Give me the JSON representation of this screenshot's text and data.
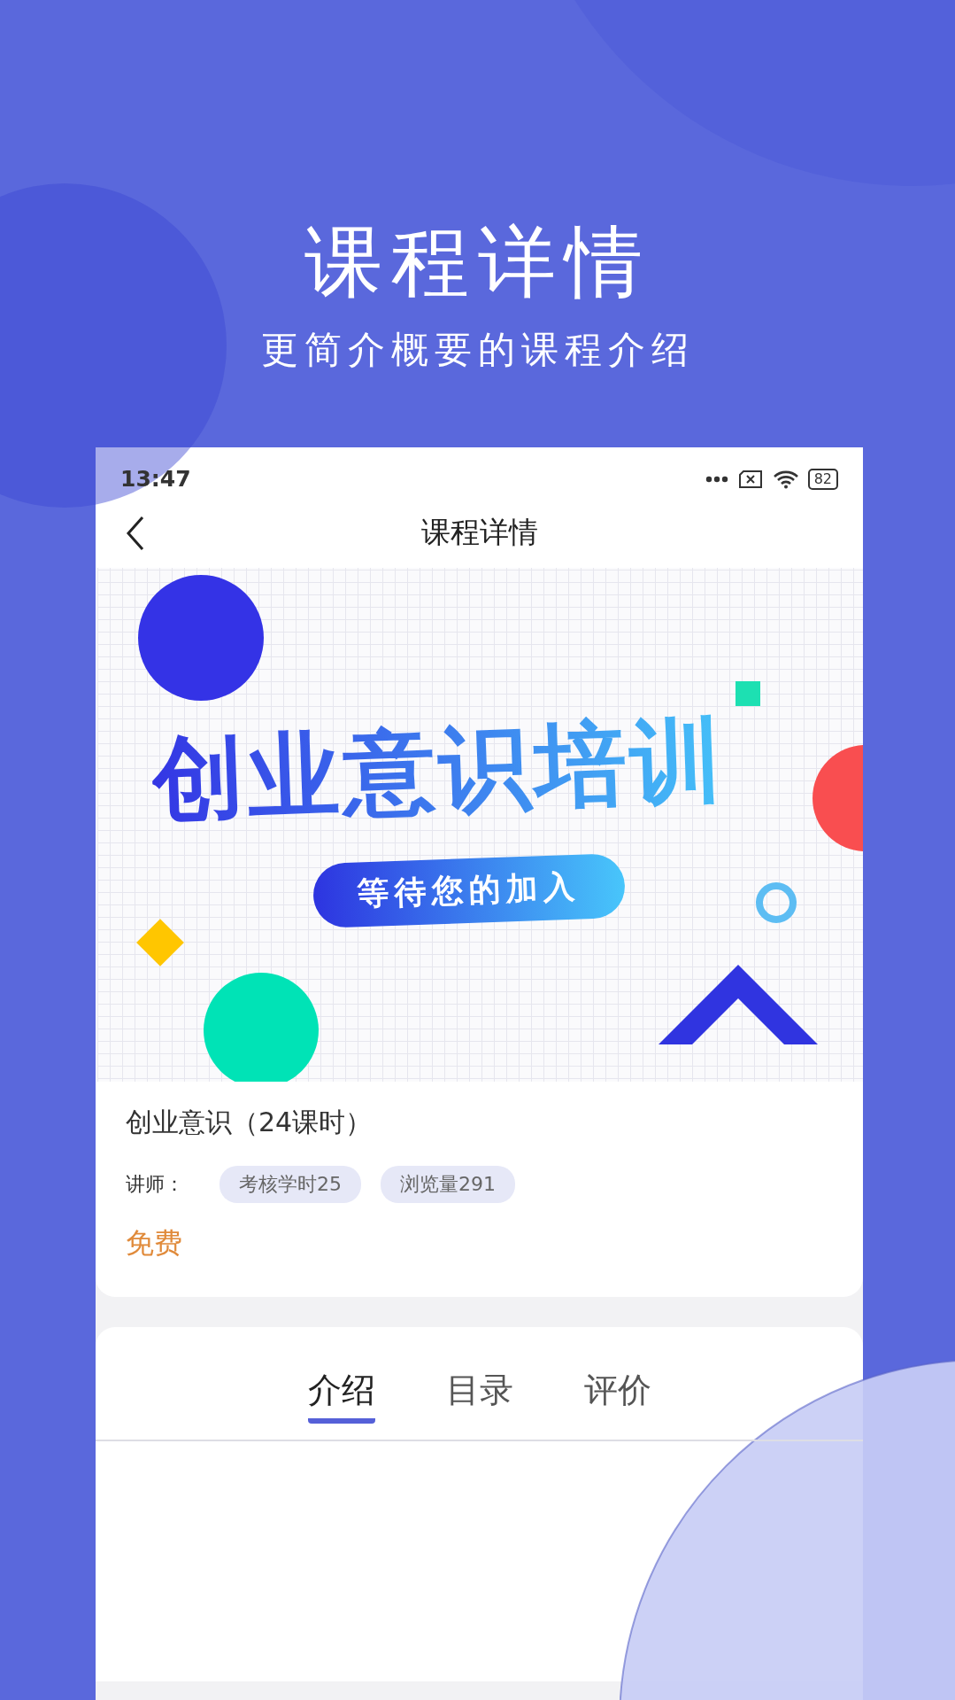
{
  "promo": {
    "title": "课程详情",
    "subtitle": "更简介概要的课程介绍"
  },
  "status_bar": {
    "time": "13:47",
    "battery": "82"
  },
  "nav": {
    "title": "课程详情"
  },
  "banner": {
    "headline": "创业意识培训",
    "pill": "等待您的加入"
  },
  "course": {
    "title": "创业意识（24课时）",
    "teacher_label": "讲师：",
    "tags": [
      "考核学时25",
      "浏览量291"
    ],
    "price": "免费"
  },
  "tabs": [
    {
      "label": "介绍",
      "selected": true
    },
    {
      "label": "目录",
      "selected": false
    },
    {
      "label": "评价",
      "selected": false
    }
  ]
}
